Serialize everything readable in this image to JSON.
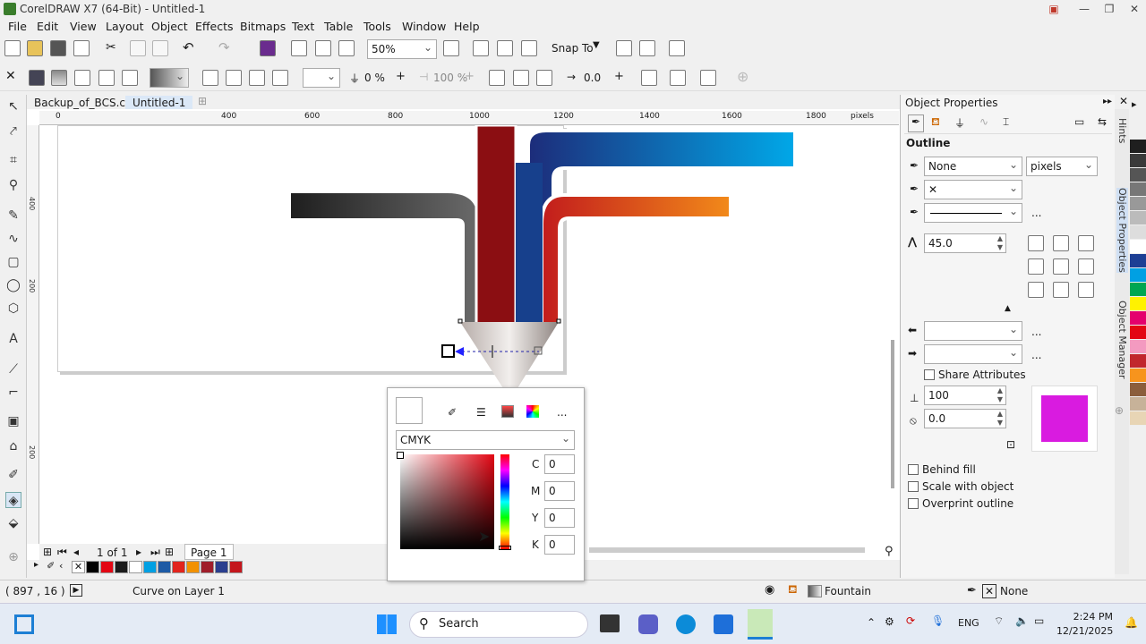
{
  "window": {
    "title": "CorelDRAW X7 (64-Bit) - Untitled-1"
  },
  "menu": [
    "File",
    "Edit",
    "View",
    "Layout",
    "Object",
    "Effects",
    "Bitmaps",
    "Text",
    "Table",
    "Tools",
    "Window",
    "Help"
  ],
  "toolbar1": {
    "zoom": "50%",
    "snap_to": "Snap To"
  },
  "toolbar2": {
    "transparency": "0 %",
    "opacity": "100 %",
    "angle": "0.0"
  },
  "tabs": [
    "Backup_of_BCS.cdr",
    "Untitled-1"
  ],
  "ruler": {
    "ticks": [
      "0",
      "400",
      "600",
      "800",
      "1000",
      "1200",
      "1400",
      "1600",
      "1800"
    ],
    "unit": "pixels",
    "vticks": [
      "400",
      "200",
      "200"
    ]
  },
  "pagebar": {
    "page_count": "1 of 1",
    "page_name": "Page 1"
  },
  "status": {
    "coords": "( 897 , 16 )",
    "object": "Curve on Layer 1",
    "fill_label": "Fountain",
    "outline_label": "None"
  },
  "docker": {
    "title": "Object Properties",
    "section": "Outline",
    "width_value": "None",
    "unit": "pixels",
    "miter": "45.0",
    "share_attributes": "Share Attributes",
    "stretch": "100",
    "angle": "0.0",
    "behind_fill": "Behind fill",
    "scale_with_object": "Scale with object",
    "overprint_outline": "Overprint outline",
    "more": "...",
    "swatch_color": "#d91be0"
  },
  "side_tabs": [
    "Hints",
    "Object Properties",
    "Object Manager"
  ],
  "color_popup": {
    "model": "CMYK",
    "c_label": "C",
    "m_label": "M",
    "y_label": "Y",
    "k_label": "K",
    "c": "0",
    "m": "0",
    "y": "0",
    "k": "0",
    "more": "..."
  },
  "taskbar": {
    "search": "Search",
    "lang": "ENG",
    "time": "2:24 PM",
    "date": "12/21/2025"
  },
  "palette_colors": [
    "#000000",
    "#e30613",
    "#1a1a1a",
    "#ffffff",
    "#00a0e3",
    "#1d5aa5",
    "#e2241c",
    "#f29100",
    "#a01e2a",
    "#2a3f8f",
    "#c4161c"
  ],
  "right_palette": [
    "#1f1f1f",
    "#3a3a3a",
    "#555555",
    "#777777",
    "#999999",
    "#bbbbbb",
    "#dddddd",
    "#ffffff",
    "#1d3f94",
    "#00a0e3",
    "#00a651",
    "#fff200",
    "#e4006d",
    "#e30613",
    "#f39ac0",
    "#c1272d",
    "#f7941d",
    "#8b5e3c",
    "#c7b299",
    "#e8d5b5"
  ]
}
